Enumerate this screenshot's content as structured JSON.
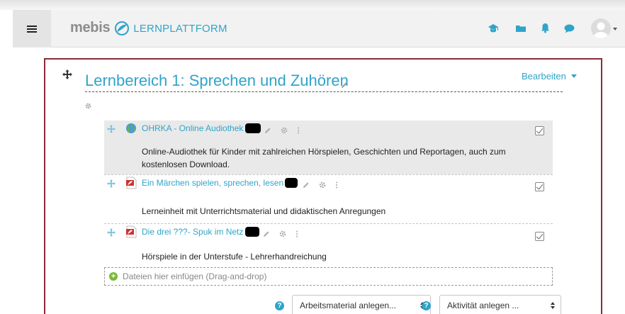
{
  "brand": {
    "name": "mebis",
    "subtitle": "LERNPLATTFORM"
  },
  "navbar": {
    "icons": [
      "graduation-cap-icon",
      "folder-icon",
      "bell-icon",
      "chat-bubble-icon"
    ],
    "accent_color": "#2fa4c9"
  },
  "section": {
    "title": "Lernbereich 1: Sprechen und Zuhören",
    "edit_label": "Bearbeiten",
    "frame_color": "#8b2a3a"
  },
  "activities": [
    {
      "name": "OHRKA - Online Audiothek",
      "icon": "globe-url-icon",
      "description_line1": "Online-Audiothek für Kinder mit zahlreichen Hörspielen, Geschichten und Reportagen, auch zum",
      "description_line2": "kostenlosen Download."
    },
    {
      "name": "Ein Märchen spielen, sprechen, lesen",
      "icon": "pdf-icon",
      "description_line1": "Lerneinheit mit Unterrichtsmaterial und didaktischen Anregungen"
    },
    {
      "name": "Die drei ???- Spuk im Netz",
      "icon": "pdf-icon",
      "description_line1": "Hörspiele in der Unterstufe - Lehrerhandreichung"
    }
  ],
  "dropzone": {
    "label": "Dateien hier einfügen (Drag-and-drop)"
  },
  "selects": {
    "material": "Arbeitsmaterial anlegen...",
    "activity": "Aktivität anlegen ..."
  }
}
